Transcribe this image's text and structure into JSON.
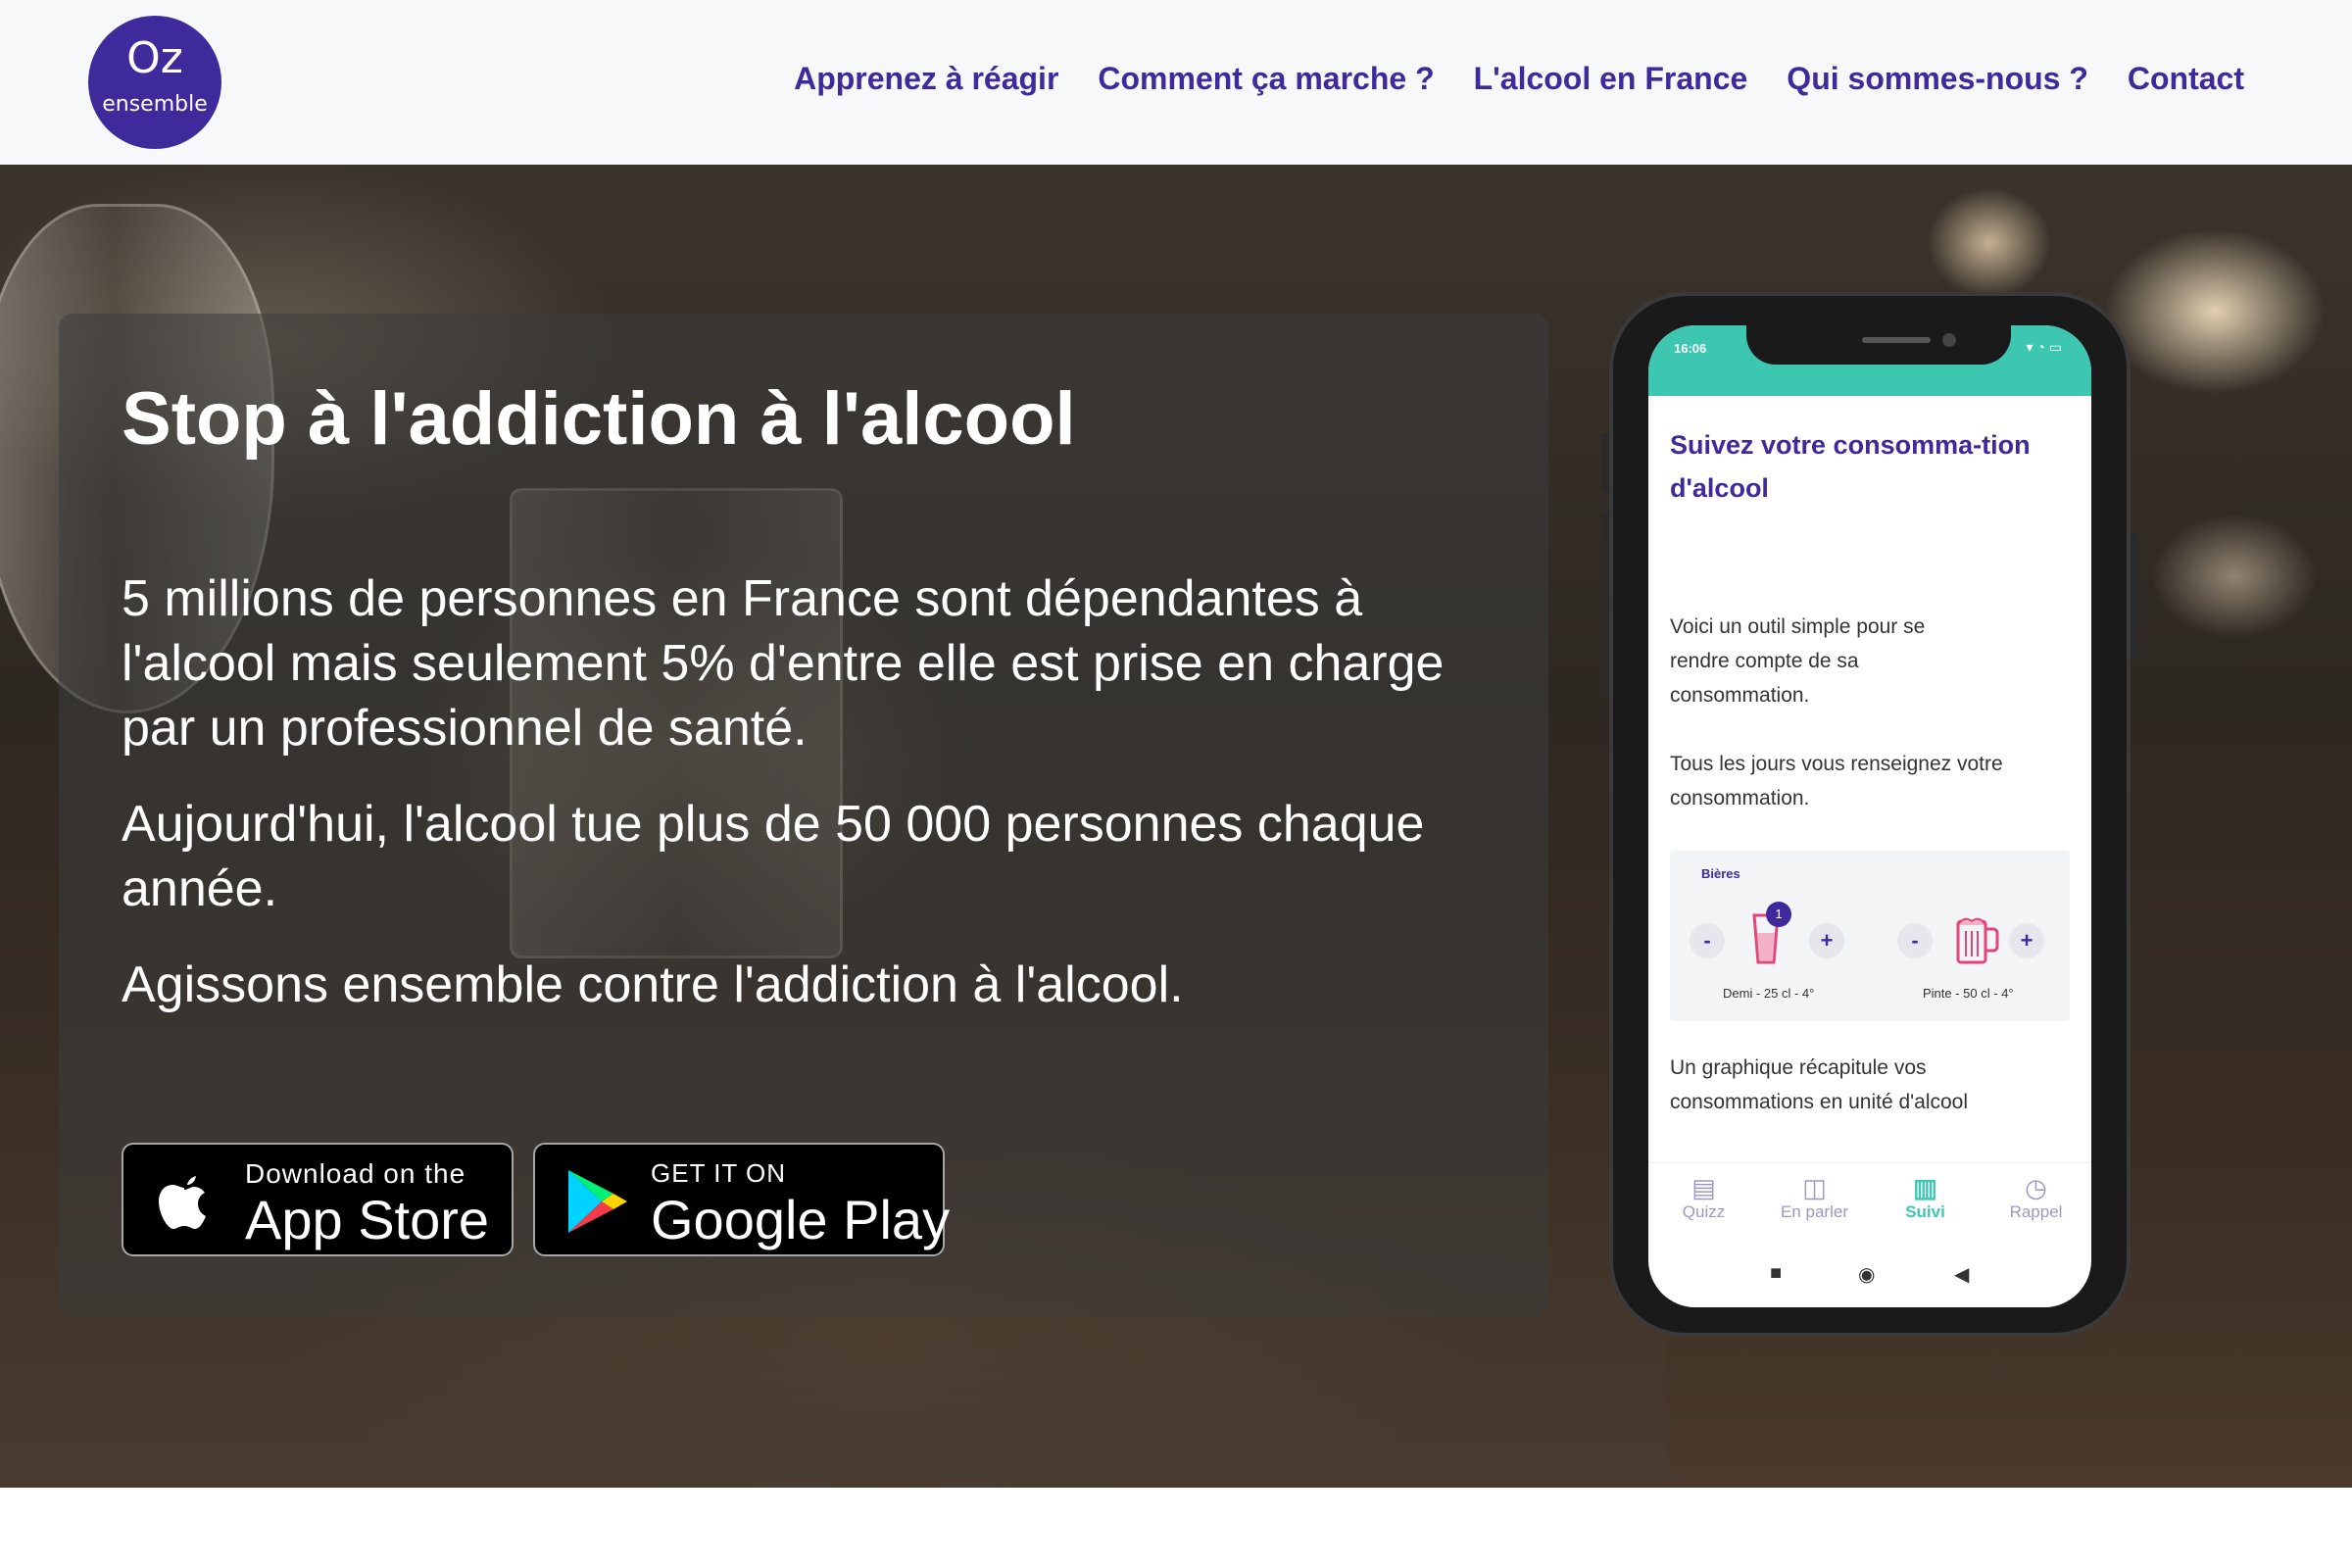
{
  "header": {
    "logo": {
      "top": "Oz",
      "bottom": "ensemble"
    },
    "nav": [
      "Apprenez à réagir",
      "Comment ça marche ?",
      "L'alcool en France",
      "Qui sommes-nous ?",
      "Contact"
    ]
  },
  "hero": {
    "title": "Stop à l'addiction à l'alcool",
    "paragraphs": [
      "5 millions de personnes en France sont dépendantes à l'alcool mais seulement 5% d'entre elle est prise en charge par un professionnel de santé.",
      "Aujourd'hui, l'alcool tue plus de 50 000 personnes chaque année.",
      "Agissons ensemble contre l'addiction à l'alcool."
    ],
    "app_store": {
      "small": "Download on the",
      "big": "App Store"
    },
    "google_play": {
      "small": "GET IT ON",
      "big": "Google Play"
    }
  },
  "phone": {
    "status_time": "16:06",
    "heading": "Suivez votre consomma-tion d'alcool",
    "text1": "Voici un outil simple pour se rendre compte de sa consommation.",
    "text2": "Tous les jours vous renseignez votre consommation.",
    "drinks": {
      "category": "Bières",
      "items": [
        {
          "label": "Demi - 25 cl - 4°",
          "count": "1",
          "minus": "-",
          "plus": "+"
        },
        {
          "label": "Pinte - 50 cl - 4°",
          "minus": "-",
          "plus": "+"
        }
      ]
    },
    "text3": "Un graphique récapitule vos consommations en unité d'alcool",
    "tabs": [
      {
        "label": "Quizz",
        "icon": "clipboard-icon"
      },
      {
        "label": "En parler",
        "icon": "chat-icon"
      },
      {
        "label": "Suivi",
        "icon": "chart-icon",
        "active": true
      },
      {
        "label": "Rappel",
        "icon": "alarm-icon"
      }
    ]
  },
  "colors": {
    "brand": "#3f2a9b",
    "teal": "#3dc7b0",
    "header_bg": "#f7f8fa"
  }
}
